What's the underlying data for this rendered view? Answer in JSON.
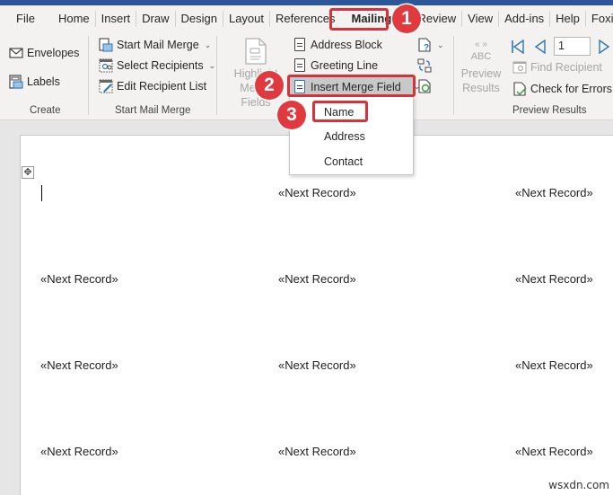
{
  "tabs": [
    {
      "label": "File"
    },
    {
      "label": "Home"
    },
    {
      "label": "Insert"
    },
    {
      "label": "Draw"
    },
    {
      "label": "Design"
    },
    {
      "label": "Layout"
    },
    {
      "label": "References"
    },
    {
      "label": "Mailings",
      "active": true
    },
    {
      "label": "Review"
    },
    {
      "label": "View"
    },
    {
      "label": "Add-ins"
    },
    {
      "label": "Help"
    },
    {
      "label": "Foxit Reader"
    }
  ],
  "ribbon": {
    "create": {
      "label": "Create",
      "envelopes": "Envelopes",
      "labels": "Labels"
    },
    "start_mail_merge": {
      "label": "Start Mail Merge",
      "start": "Start Mail Merge",
      "select_recipients": "Select Recipients",
      "edit_recipient_list": "Edit Recipient List"
    },
    "write_insert": {
      "highlight_line1": "Highlight",
      "highlight_line2": "Merge Fields",
      "address_block": "Address Block",
      "greeting_line": "Greeting Line",
      "insert_merge_field": "Insert Merge Field"
    },
    "preview": {
      "label": "Preview Results",
      "abc": "ABC",
      "preview_line1": "Preview",
      "preview_line2": "Results",
      "record_number": "1",
      "find_recipient": "Find Recipient",
      "check_for_errors": "Check for Errors"
    }
  },
  "merge_field_menu": {
    "items": [
      "Name",
      "Address",
      "Contact"
    ]
  },
  "document": {
    "move_handle_icon": "✥",
    "rows": [
      [
        "",
        "«Next Record»",
        "«Next Record»"
      ],
      [
        "«Next Record»",
        "«Next Record»",
        "«Next Record»"
      ],
      [
        "«Next Record»",
        "«Next Record»",
        "«Next Record»"
      ],
      [
        "«Next Record»",
        "«Next Record»",
        "«Next Record»"
      ]
    ]
  },
  "annotations": {
    "step1": "1",
    "step2": "2",
    "step3": "3",
    "color": "#e03a3e"
  },
  "watermark": "wsxdn.com"
}
